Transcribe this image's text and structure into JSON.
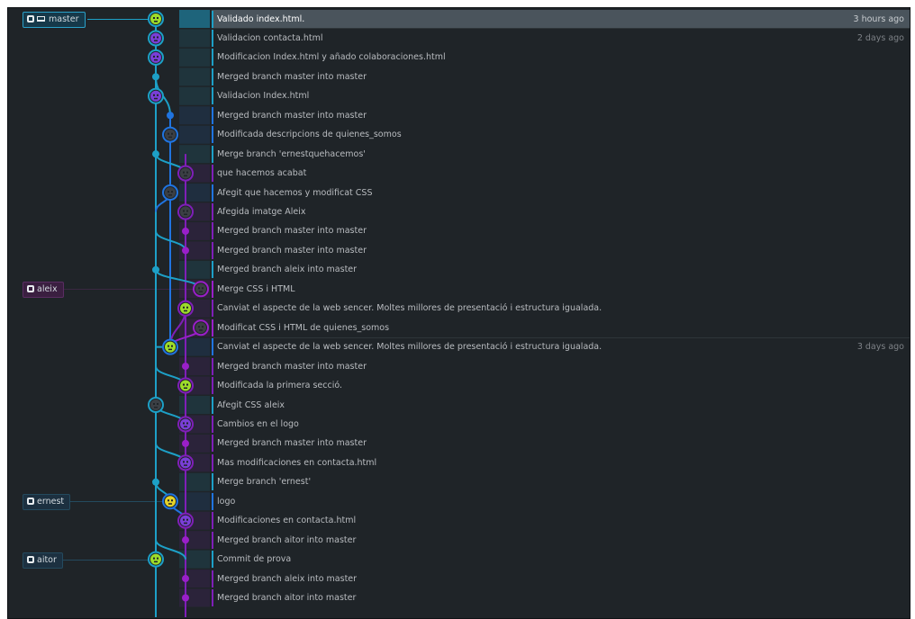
{
  "colors": {
    "master": "#1da0c7",
    "blue": "#2074e0",
    "purple": "#7f1fb8",
    "magenta": "#9a1fc9",
    "selected": "#4a545c",
    "avatar_green": "#9ddc2a",
    "avatar_purple": "#7a3fd8",
    "avatar_yellow": "#e4d22a"
  },
  "branches": [
    {
      "name": "master",
      "icons": [
        "git-icon",
        "laptop-icon"
      ],
      "row": 0,
      "style": "master"
    },
    {
      "name": "aleix",
      "icons": [
        "git-icon"
      ],
      "row": 14,
      "style": "aleix"
    },
    {
      "name": "ernest",
      "icons": [
        "git-icon"
      ],
      "row": 25,
      "style": "ernest"
    },
    {
      "name": "aitor",
      "icons": [
        "git-icon"
      ],
      "row": 28,
      "style": "aitor"
    }
  ],
  "commits": [
    {
      "message": "Validado index.html.",
      "time": "3 hours ago",
      "lane": 0,
      "avatar": "green",
      "selected": true
    },
    {
      "message": "Validacion contacta.html",
      "time": "2 days ago",
      "lane": 0,
      "avatar": "purple"
    },
    {
      "message": "Modificacion Index.html y añado colaboraciones.html",
      "time": "",
      "lane": 0,
      "avatar": "purple"
    },
    {
      "message": "Merged branch master into master",
      "time": "",
      "lane": 0,
      "avatar": "dot"
    },
    {
      "message": "Validacion Index.html",
      "time": "",
      "lane": 0,
      "avatar": "purple"
    },
    {
      "message": "Merged branch master into master",
      "time": "",
      "lane": 1,
      "avatar": "dot-blue"
    },
    {
      "message": "Modificada descripcions de quienes_somos",
      "time": "",
      "lane": 1,
      "avatar": "photo"
    },
    {
      "message": "Merge branch 'ernestquehacemos'",
      "time": "",
      "lane": 0,
      "avatar": "dot"
    },
    {
      "message": "que hacemos acabat",
      "time": "",
      "lane": 2,
      "avatar": "photo"
    },
    {
      "message": "Afegit que hacemos y modificat CSS",
      "time": "",
      "lane": 1,
      "avatar": "photo"
    },
    {
      "message": "Afegida imatge Aleix",
      "time": "",
      "lane": 2,
      "avatar": "photo"
    },
    {
      "message": "Merged branch master into master",
      "time": "",
      "lane": 2,
      "avatar": "dot-purple"
    },
    {
      "message": "Merged branch master into master",
      "time": "",
      "lane": 2,
      "avatar": "dot-purple"
    },
    {
      "message": "Merged branch aleix into master",
      "time": "",
      "lane": 0,
      "avatar": "dot"
    },
    {
      "message": "Merge CSS i HTML",
      "time": "",
      "lane": 3,
      "avatar": "photo"
    },
    {
      "message": "Canviat el aspecte de la web sencer. Moltes millores de presentació i estructura igualada.",
      "time": "",
      "lane": 2,
      "avatar": "green"
    },
    {
      "message": "Modificat CSS i HTML de quienes_somos",
      "time": "",
      "lane": 3,
      "avatar": "photo"
    },
    {
      "message": "Canviat el aspecte de la web sencer. Moltes millores de presentació i estructura igualada.",
      "time": "3 days ago",
      "lane": 1,
      "avatar": "green"
    },
    {
      "message": "Merged branch master into master",
      "time": "",
      "lane": 2,
      "avatar": "dot-purple"
    },
    {
      "message": "Modificada la primera secció.",
      "time": "",
      "lane": 2,
      "avatar": "green"
    },
    {
      "message": "Afegit CSS aleix",
      "time": "",
      "lane": 0,
      "avatar": "photo"
    },
    {
      "message": "Cambios en el logo",
      "time": "",
      "lane": 2,
      "avatar": "purple"
    },
    {
      "message": "Merged branch master into master",
      "time": "",
      "lane": 2,
      "avatar": "dot-purple"
    },
    {
      "message": "Mas modificaciones en contacta.html",
      "time": "",
      "lane": 2,
      "avatar": "purple"
    },
    {
      "message": "Merge branch 'ernest'",
      "time": "",
      "lane": 0,
      "avatar": "dot"
    },
    {
      "message": "logo",
      "time": "",
      "lane": 1,
      "avatar": "yellow"
    },
    {
      "message": "Modificaciones en contacta.html",
      "time": "",
      "lane": 2,
      "avatar": "purple"
    },
    {
      "message": "Merged branch aitor into master",
      "time": "",
      "lane": 2,
      "avatar": "dot-purple"
    },
    {
      "message": "Commit de prova",
      "time": "",
      "lane": 0,
      "avatar": "green"
    },
    {
      "message": "Merged branch aleix into master",
      "time": "",
      "lane": 2,
      "avatar": "dot-purple"
    },
    {
      "message": "Merged branch aitor into master",
      "time": "",
      "lane": 2,
      "avatar": "dot-purple"
    }
  ]
}
